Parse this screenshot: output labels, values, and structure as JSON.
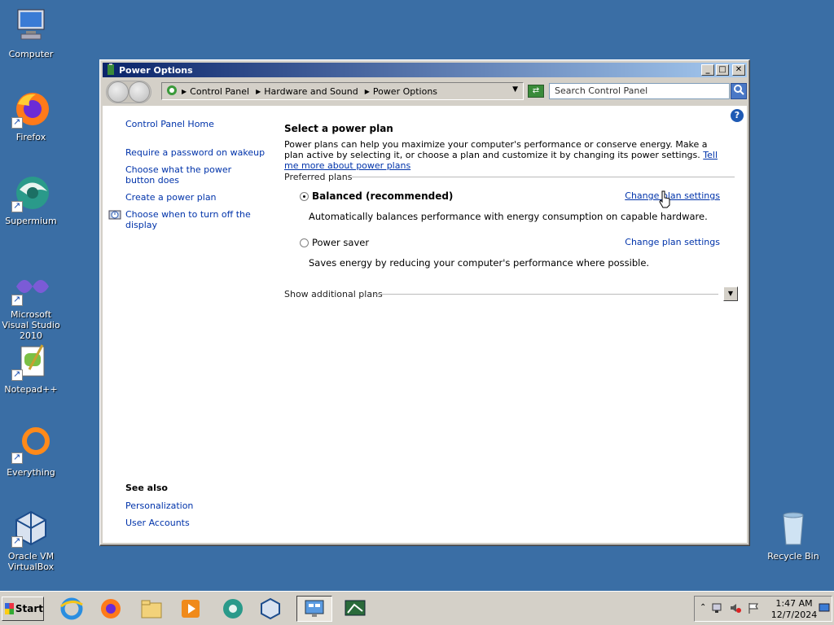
{
  "desktop": {
    "icons": [
      {
        "label": "Computer",
        "icon": "computer-icon"
      },
      {
        "label": "Firefox",
        "icon": "firefox-icon"
      },
      {
        "label": "Supermium",
        "icon": "supermium-icon"
      },
      {
        "label": "Microsoft Visual Studio 2010",
        "icon": "visual-studio-icon"
      },
      {
        "label": "Notepad++",
        "icon": "notepadpp-icon"
      },
      {
        "label": "Everything",
        "icon": "everything-icon"
      },
      {
        "label": "Oracle VM VirtualBox",
        "icon": "virtualbox-icon"
      },
      {
        "label": "Recycle Bin",
        "icon": "recycle-bin-icon"
      }
    ]
  },
  "window": {
    "title": "Power Options",
    "address": {
      "crumbs": [
        "Control Panel",
        "Hardware and Sound",
        "Power Options"
      ]
    },
    "search": {
      "placeholder": "Search Control Panel"
    }
  },
  "sidebar": {
    "home": "Control Panel Home",
    "links": [
      "Require a password on wakeup",
      "Choose what the power button does",
      "Create a power plan",
      "Choose when to turn off the display"
    ],
    "see_also_title": "See also",
    "see_also": [
      "Personalization",
      "User Accounts"
    ]
  },
  "main": {
    "heading": "Select a power plan",
    "description": "Power plans can help you maximize your computer's performance or conserve energy. Make a plan active by selecting it, or choose a plan and customize it by changing its power settings.",
    "tell_more": "Tell me more about power plans",
    "preferred_label": "Preferred plans",
    "plans": [
      {
        "name": "Balanced (recommended)",
        "selected": true,
        "description": "Automatically balances performance with energy consumption on capable hardware.",
        "change": "Change plan settings"
      },
      {
        "name": "Power saver",
        "selected": false,
        "description": "Saves energy by reducing your computer's performance where possible.",
        "change": "Change plan settings"
      }
    ],
    "additional_label": "Show additional plans"
  },
  "taskbar": {
    "start_label": "Start",
    "clock_time": "1:47 AM",
    "clock_date": "12/7/2024"
  },
  "colors": {
    "desktop": "#3a6ea5",
    "link": "#0033aa",
    "titlebar_start": "#0a246a",
    "titlebar_end": "#a6caf0"
  }
}
